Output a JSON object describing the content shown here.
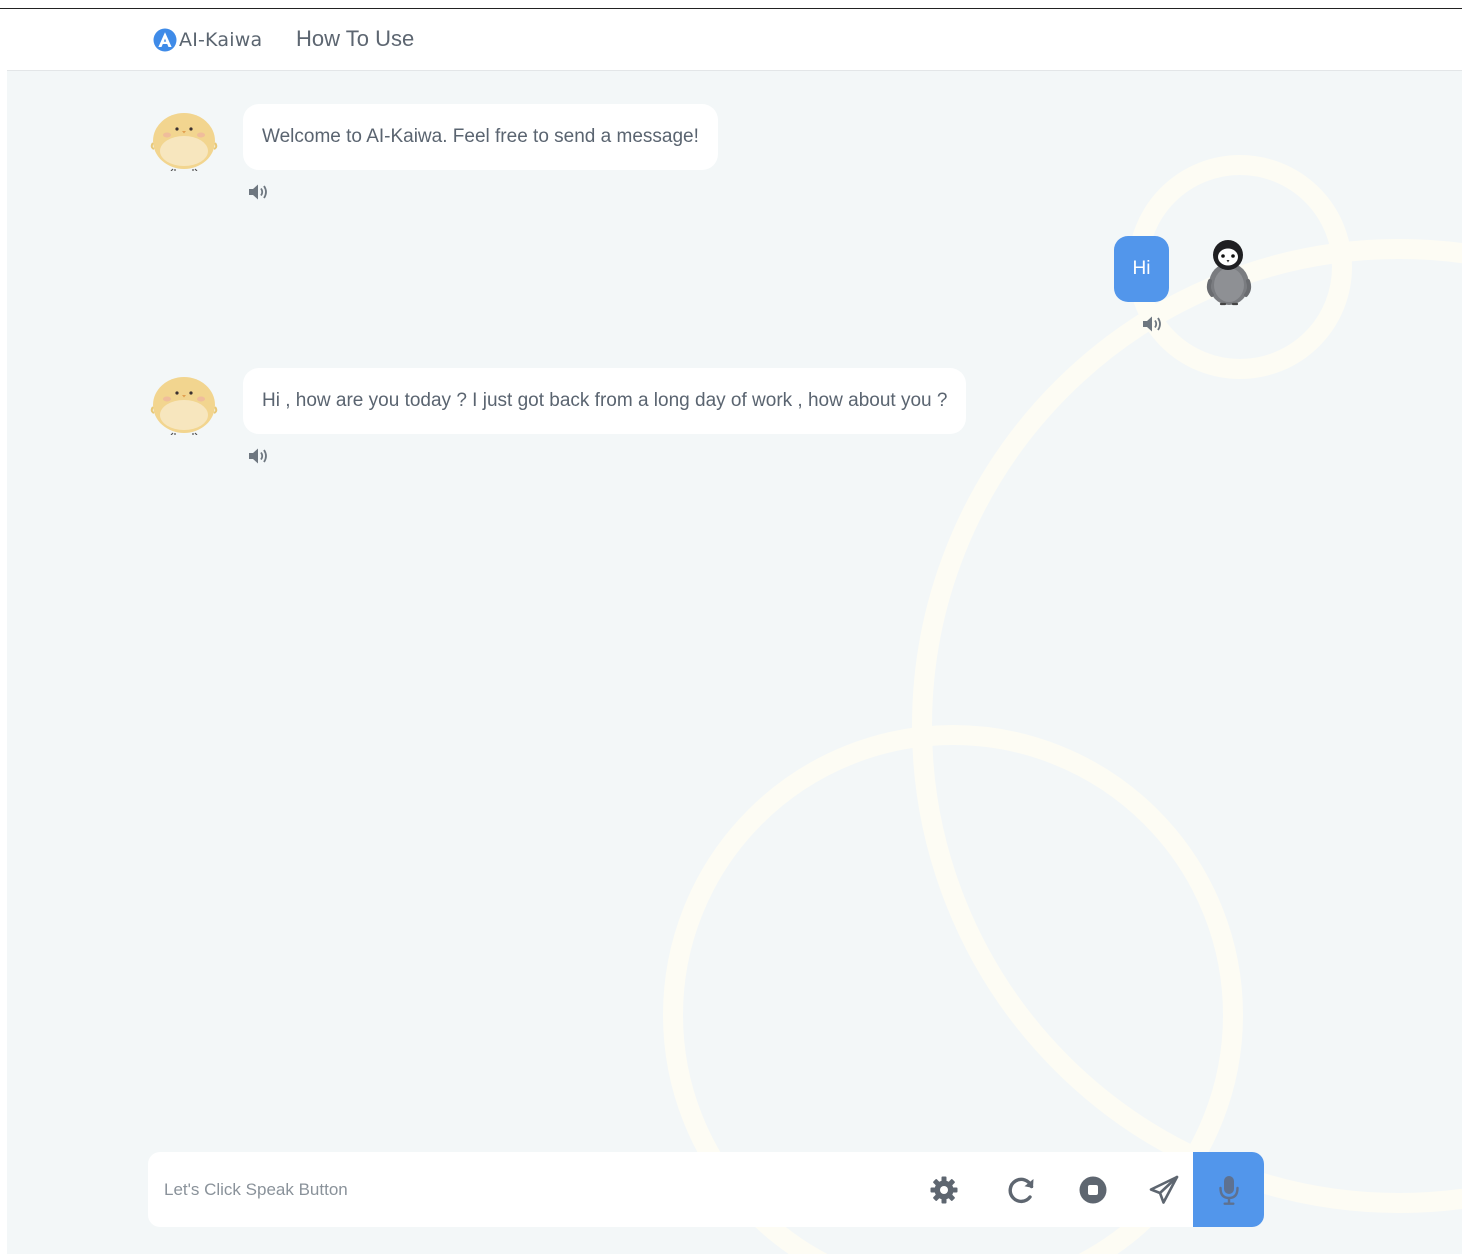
{
  "header": {
    "brand": "AI-Kaiwa",
    "nav_how_to_use": "How To Use"
  },
  "messages": [
    {
      "role": "assistant",
      "text": "Welcome to AI-Kaiwa. Feel free to send a message!",
      "avatar": "chick-avatar"
    },
    {
      "role": "user",
      "text": "Hi",
      "avatar": "penguin-avatar"
    },
    {
      "role": "assistant",
      "text": "Hi , how are you today ? I just got back from a long day of work , how about you ?",
      "avatar": "chick-avatar"
    }
  ],
  "composer": {
    "placeholder": "Let's Click Speak Button",
    "value": "",
    "tools": [
      "gear-icon",
      "redo-icon",
      "stop-icon",
      "send-icon",
      "microphone-icon"
    ]
  },
  "colors": {
    "accent": "#5296eb",
    "background": "#f3f7f8",
    "text": "#5a6470"
  }
}
